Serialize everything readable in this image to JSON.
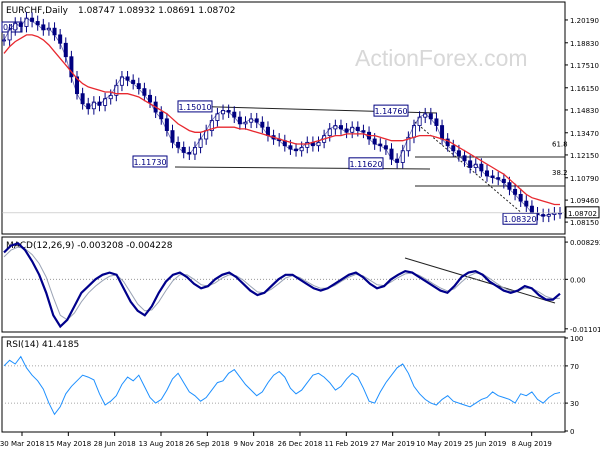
{
  "header": {
    "symbol": "EURCHF,Daily",
    "ohlc": "1.08747 1.08932 1.08691 1.08702"
  },
  "watermark": "ActionForex.com",
  "colors": {
    "candle": "#000080",
    "ma": "#e8282f",
    "macd": "#00008b",
    "signal": "#9aa3b5",
    "rsi": "#1e90ff",
    "trend": "#222222",
    "last_price_bg": "#ffffff"
  },
  "chart_data": [
    {
      "type": "line",
      "panel": "price",
      "title": "EURCHF,Daily",
      "ylim": [
        1.075,
        1.212
      ],
      "yticks": [
        "1.20190",
        "1.18830",
        "1.17510",
        "1.16150",
        "1.14830",
        "1.13470",
        "1.12150",
        "1.10790",
        "1.09460",
        "1.08150"
      ],
      "ytick_values": [
        1.2019,
        1.1883,
        1.1751,
        1.1615,
        1.1483,
        1.1347,
        1.1215,
        1.1079,
        1.0946,
        1.0815
      ],
      "xticks": [
        "30 Mar 2018",
        "15 May 2018",
        "28 Jun 2018",
        "13 Aug 2018",
        "26 Sep 2018",
        "9 Nov 2018",
        "26 Dec 2018",
        "11 Feb 2019",
        "27 Mar 2019",
        "10 May 2019",
        "25 Jun 2019",
        "8 Aug 2019"
      ],
      "series": [
        {
          "values": [
            1.19,
            1.196,
            1.2,
            1.198,
            1.203,
            1.201,
            1.199,
            1.196,
            1.197,
            1.193,
            1.188,
            1.18,
            1.168,
            1.158,
            1.152,
            1.149,
            1.153,
            1.151,
            1.155,
            1.157,
            1.163,
            1.168,
            1.166,
            1.164,
            1.161,
            1.157,
            1.153,
            1.147,
            1.143,
            1.136,
            1.129,
            1.126,
            1.123,
            1.122,
            1.126,
            1.131,
            1.136,
            1.142,
            1.146,
            1.148,
            1.147,
            1.144,
            1.14,
            1.141,
            1.143,
            1.141,
            1.138,
            1.133,
            1.131,
            1.13,
            1.127,
            1.125,
            1.124,
            1.126,
            1.129,
            1.127,
            1.129,
            1.133,
            1.137,
            1.139,
            1.137,
            1.135,
            1.138,
            1.136,
            1.135,
            1.131,
            1.128,
            1.127,
            1.125,
            1.119,
            1.117,
            1.124,
            1.132,
            1.139,
            1.144,
            1.146,
            1.143,
            1.139,
            1.131,
            1.127,
            1.124,
            1.121,
            1.118,
            1.114,
            1.116,
            1.112,
            1.109,
            1.108,
            1.107,
            1.105,
            1.101,
            1.098,
            1.094,
            1.091,
            1.087,
            1.086,
            1.085,
            1.086,
            1.087,
            1.087
          ]
        },
        {
          "values": [
            1.182,
            1.186,
            1.189,
            1.191,
            1.193,
            1.193,
            1.192,
            1.19,
            1.187,
            1.183,
            1.179,
            1.175,
            1.171,
            1.167,
            1.164,
            1.162,
            1.161,
            1.16,
            1.159,
            1.159,
            1.158,
            1.158,
            1.158,
            1.157,
            1.156,
            1.154,
            1.152,
            1.15,
            1.148,
            1.146,
            1.143,
            1.14,
            1.138,
            1.136,
            1.135,
            1.135,
            1.136,
            1.137,
            1.138,
            1.138,
            1.138,
            1.138,
            1.137,
            1.137,
            1.136,
            1.135,
            1.134,
            1.133,
            1.132,
            1.131,
            1.13,
            1.129,
            1.128,
            1.128,
            1.128,
            1.129,
            1.13,
            1.131,
            1.132,
            1.133,
            1.133,
            1.134,
            1.134,
            1.134,
            1.134,
            1.133,
            1.133,
            1.132,
            1.131,
            1.13,
            1.13,
            1.13,
            1.131,
            1.132,
            1.133,
            1.133,
            1.133,
            1.132,
            1.131,
            1.13,
            1.128,
            1.126,
            1.124,
            1.122,
            1.12,
            1.118,
            1.116,
            1.114,
            1.112,
            1.11,
            1.107,
            1.104,
            1.101,
            1.098,
            1.096,
            1.095,
            1.094,
            1.093,
            1.092,
            1.092
          ]
        }
      ],
      "annotations": [
        {
          "text": "1.15010",
          "value": 1.1501
        },
        {
          "text": "1.14760",
          "value": 1.1476
        },
        {
          "text": "1.11730",
          "value": 1.1173
        },
        {
          "text": "1.11620",
          "value": 1.1162
        },
        {
          "text": "1.08320",
          "value": 1.0832
        },
        {
          "text": "61.8",
          "value": 1.1248
        },
        {
          "text": "38.2",
          "value": 1.1079
        }
      ],
      "last_price": {
        "text": "1.08702",
        "value": 1.08702
      },
      "left_cut_label": "048"
    },
    {
      "type": "line",
      "panel": "macd",
      "title": "MACD(12,26,9) -0.003208 -0.004228",
      "ylim": [
        -0.0115,
        0.0092
      ],
      "yticks": [
        "0.008292",
        "0.00",
        "-0.011015"
      ],
      "ytick_values": [
        0.008292,
        0.0,
        -0.011015
      ],
      "series": [
        {
          "values": [
            0.006,
            0.0075,
            0.008,
            0.0065,
            0.004,
            0.001,
            -0.003,
            -0.008,
            -0.0105,
            -0.009,
            -0.006,
            -0.003,
            -0.0015,
            0.0,
            0.001,
            0.0015,
            0.001,
            -0.002,
            -0.005,
            -0.007,
            -0.008,
            -0.006,
            -0.003,
            -0.0005,
            0.001,
            0.0015,
            0.0005,
            -0.001,
            -0.002,
            -0.0015,
            0.0,
            0.001,
            0.0015,
            0.0005,
            -0.001,
            -0.0025,
            -0.0035,
            -0.003,
            -0.0015,
            0.0,
            0.001,
            0.001,
            0.0,
            -0.001,
            -0.002,
            -0.0025,
            -0.002,
            -0.001,
            0.0,
            0.001,
            0.0015,
            0.0005,
            -0.001,
            -0.002,
            -0.0015,
            0.0,
            0.001,
            0.0018,
            0.0015,
            0.0005,
            -0.0005,
            -0.0015,
            -0.0025,
            -0.003,
            -0.0015,
            0.0005,
            0.0015,
            0.0018,
            0.001,
            -0.0005,
            -0.0015,
            -0.0025,
            -0.003,
            -0.0025,
            -0.0015,
            -0.002,
            -0.0035,
            -0.0045,
            -0.0045,
            -0.0032
          ]
        },
        {
          "values": [
            0.005,
            0.0065,
            0.0072,
            0.0068,
            0.0055,
            0.0035,
            0.0005,
            -0.004,
            -0.008,
            -0.009,
            -0.0075,
            -0.005,
            -0.003,
            -0.0015,
            -0.0003,
            0.0007,
            0.001,
            -0.0005,
            -0.003,
            -0.0055,
            -0.007,
            -0.0068,
            -0.005,
            -0.0025,
            -0.0003,
            0.001,
            0.001,
            0.0,
            -0.0012,
            -0.0015,
            -0.0008,
            0.0003,
            0.001,
            0.0008,
            -0.0002,
            -0.0015,
            -0.0028,
            -0.003,
            -0.0022,
            -0.001,
            0.0003,
            0.0008,
            0.0004,
            -0.0005,
            -0.0014,
            -0.002,
            -0.002,
            -0.0014,
            -0.0004,
            0.0005,
            0.0011,
            0.0008,
            -0.0002,
            -0.0012,
            -0.0014,
            -0.0006,
            0.0004,
            0.0012,
            0.0014,
            0.0009,
            0.0,
            -0.001,
            -0.0019,
            -0.0026,
            -0.0021,
            -0.0006,
            0.0007,
            0.0014,
            0.0012,
            0.0002,
            -0.0009,
            -0.0019,
            -0.0026,
            -0.0026,
            -0.002,
            -0.002,
            -0.0028,
            -0.0038,
            -0.0043,
            -0.0042
          ]
        }
      ]
    },
    {
      "type": "line",
      "panel": "rsi",
      "title": "RSI(14) 41.4185",
      "ylim": [
        0,
        100
      ],
      "yticks": [
        "100",
        "70",
        "30",
        "0"
      ],
      "ytick_values": [
        100,
        70,
        30,
        0
      ],
      "series": [
        {
          "values": [
            70,
            76,
            72,
            80,
            68,
            60,
            54,
            45,
            30,
            18,
            26,
            40,
            48,
            54,
            60,
            58,
            55,
            40,
            28,
            32,
            38,
            50,
            58,
            54,
            60,
            48,
            36,
            30,
            34,
            44,
            56,
            62,
            52,
            42,
            38,
            32,
            36,
            44,
            52,
            54,
            62,
            66,
            58,
            50,
            44,
            38,
            42,
            52,
            60,
            64,
            58,
            46,
            40,
            44,
            52,
            60,
            62,
            58,
            52,
            44,
            48,
            56,
            62,
            58,
            46,
            32,
            30,
            42,
            52,
            60,
            68,
            72,
            62,
            48,
            40,
            34,
            30,
            28,
            34,
            38,
            32,
            30,
            28,
            26,
            30,
            34,
            36,
            42,
            38,
            36,
            34,
            30,
            40,
            38,
            42,
            34,
            30,
            36,
            40,
            41.4
          ]
        }
      ]
    }
  ]
}
